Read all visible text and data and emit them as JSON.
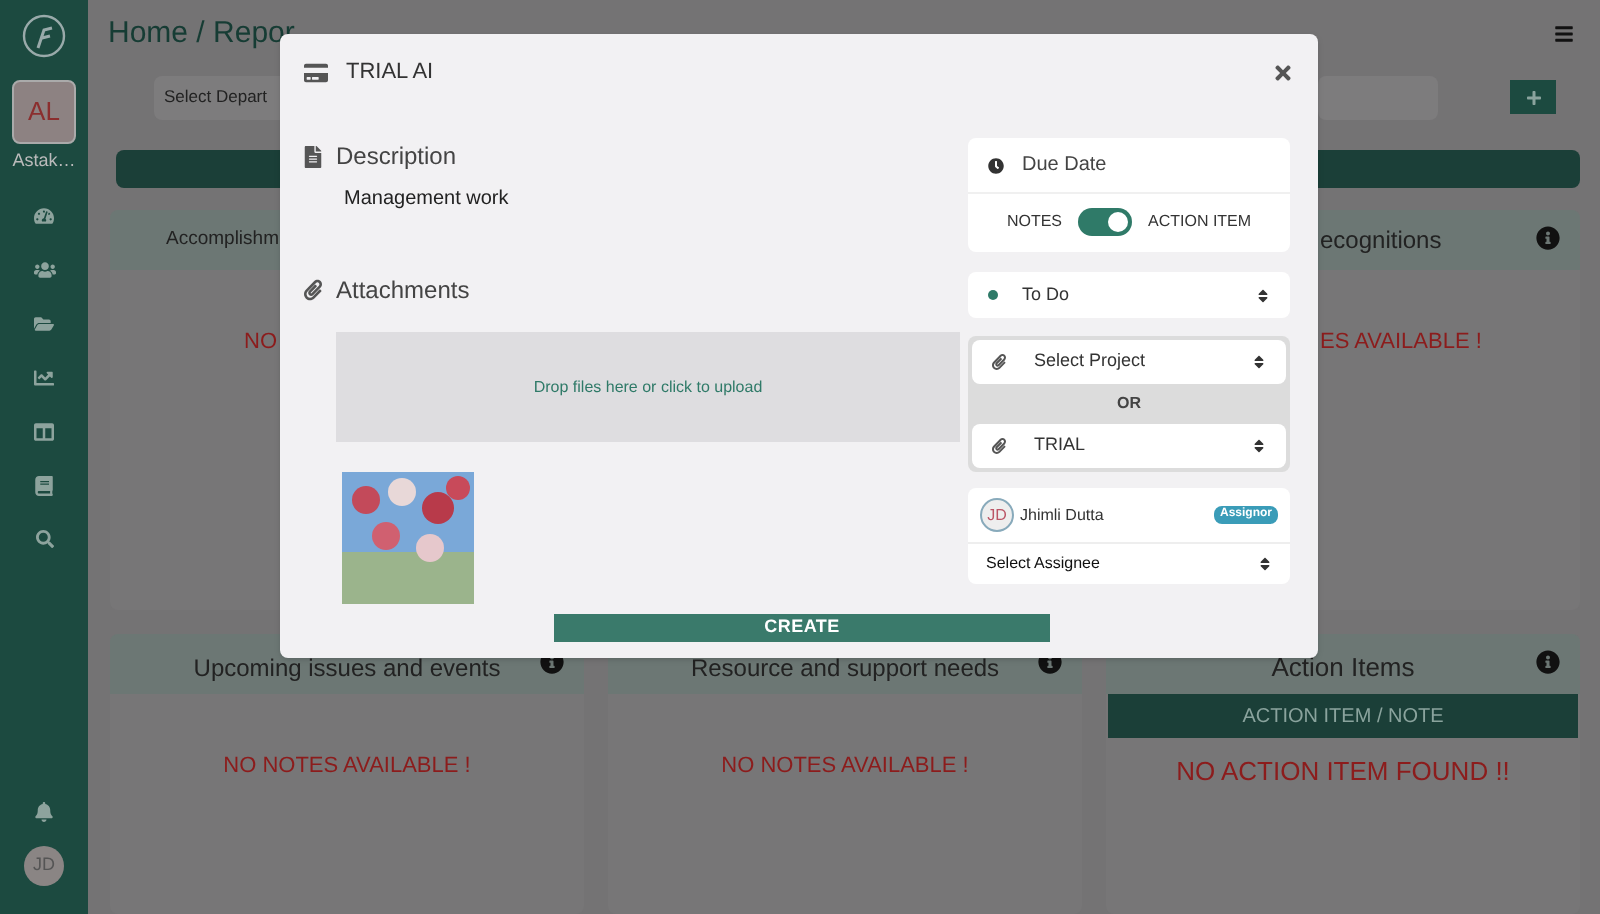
{
  "sidebar": {
    "avatar": "AL",
    "user": "Astak…",
    "avatar_bottom": "JD"
  },
  "header": {
    "breadcrumb": "Home / Repor",
    "department": "Select Depart"
  },
  "cards": [
    {
      "title": "Accomplishm",
      "message": "NO"
    },
    {
      "title": "ecognitions",
      "message": "ES AVAILABLE !"
    },
    {
      "title": "Upcoming issues and events",
      "message": "NO NOTES AVAILABLE !"
    },
    {
      "title": "Resource and support needs",
      "message": "NO NOTES AVAILABLE !"
    },
    {
      "title": "Action Items",
      "tab": "ACTION ITEM / NOTE",
      "message": "NO ACTION ITEM FOUND !!"
    }
  ],
  "modal": {
    "title": "TRIAL AI",
    "description_label": "Description",
    "description": "Management work",
    "attachments_label": "Attachments",
    "dropzone": "Drop files here or click to upload",
    "due_date": "Due Date",
    "toggle": {
      "left": "NOTES",
      "right": "ACTION ITEM",
      "on": true
    },
    "status": {
      "label": "To Do",
      "color": "#2f7a68"
    },
    "project": "Select Project",
    "or": "OR",
    "project_selected": "TRIAL",
    "assigner": {
      "initials": "JD",
      "name": "Jhimli Dutta",
      "badge": "Assignor"
    },
    "assignee": "Select Assignee",
    "submit": "CREATE"
  }
}
